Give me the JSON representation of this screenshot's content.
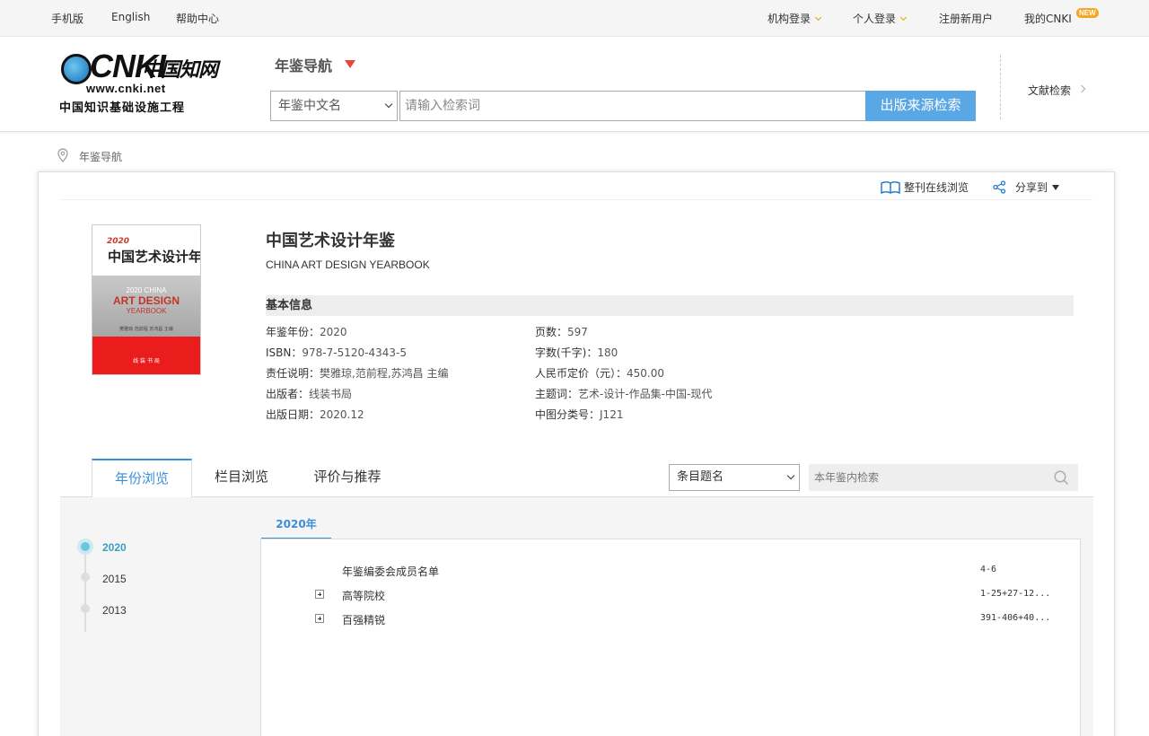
{
  "topbar": {
    "mobile": "手机版",
    "english": "English",
    "help": "帮助中心",
    "org_login": "机构登录",
    "personal_login": "个人登录",
    "register": "注册新用户",
    "my_cnki": "我的CNKI",
    "new_badge": "NEW"
  },
  "header": {
    "logo_text": "CNKI",
    "logo_cn": "中国知网",
    "logo_url": "www.cnki.net",
    "logo_slogan": "中国知识基础设施工程",
    "nav_title": "年鉴导航",
    "search_scope": "年鉴中文名",
    "search_placeholder": "请输入检索词",
    "search_button": "出版来源检索",
    "literature_search": "文献检索"
  },
  "breadcrumb": {
    "current": "年鉴导航"
  },
  "toolbar": {
    "browse_online": "整刊在线浏览",
    "share": "分享到"
  },
  "cover": {
    "year": "2020",
    "cn_title": "中国艺术设计年鉴",
    "en_line1": "2020 CHINA",
    "en_line2": "ART DESIGN",
    "en_line3": "YEARBOOK",
    "editors": "樊雅琼 范前程 苏鸿昌 主编",
    "publisher": "线 装 书 局"
  },
  "book": {
    "title": "中国艺术设计年鉴",
    "en_title": "CHINA ART DESIGN YEARBOOK",
    "basic_info_header": "基本信息",
    "info_left": [
      {
        "label": "年鉴年份：",
        "value": "2020"
      },
      {
        "label": "ISBN：",
        "value": "978-7-5120-4343-5"
      },
      {
        "label": "责任说明：",
        "value": "樊雅琼,范前程,苏鸿昌 主编"
      },
      {
        "label": "出版者：",
        "value": "线装书局"
      },
      {
        "label": "出版日期：",
        "value": "2020.12"
      }
    ],
    "info_right": [
      {
        "label": "页数：",
        "value": "597"
      },
      {
        "label": "字数(千字)：",
        "value": "180"
      },
      {
        "label": "人民币定价（元）：",
        "value": "450.00"
      },
      {
        "label": "主题词：",
        "value": "艺术-设计-作品集-中国-现代"
      },
      {
        "label": "中图分类号：",
        "value": "J121"
      }
    ]
  },
  "tabs": [
    {
      "label": "年份浏览",
      "active": true
    },
    {
      "label": "栏目浏览",
      "active": false
    },
    {
      "label": "评价与推荐",
      "active": false
    }
  ],
  "inner_search": {
    "field": "条目题名",
    "placeholder": "本年鉴内检索"
  },
  "years": [
    {
      "label": "2020",
      "active": true
    },
    {
      "label": "2015",
      "active": false
    },
    {
      "label": "2013",
      "active": false
    }
  ],
  "year_tab": "2020年",
  "entries": [
    {
      "title": "年鉴编委会成员名单",
      "pages": "4-6",
      "expandable": false
    },
    {
      "title": "高等院校",
      "pages": "1-25+27-12...",
      "expandable": true
    },
    {
      "title": "百强精锐",
      "pages": "391-406+40...",
      "expandable": true
    }
  ],
  "colors": {
    "accent_blue": "#3a8fd6",
    "search_button": "#5aa7e6",
    "nav_triangle": "#e8453c",
    "cover_red": "#ea1c1c"
  }
}
